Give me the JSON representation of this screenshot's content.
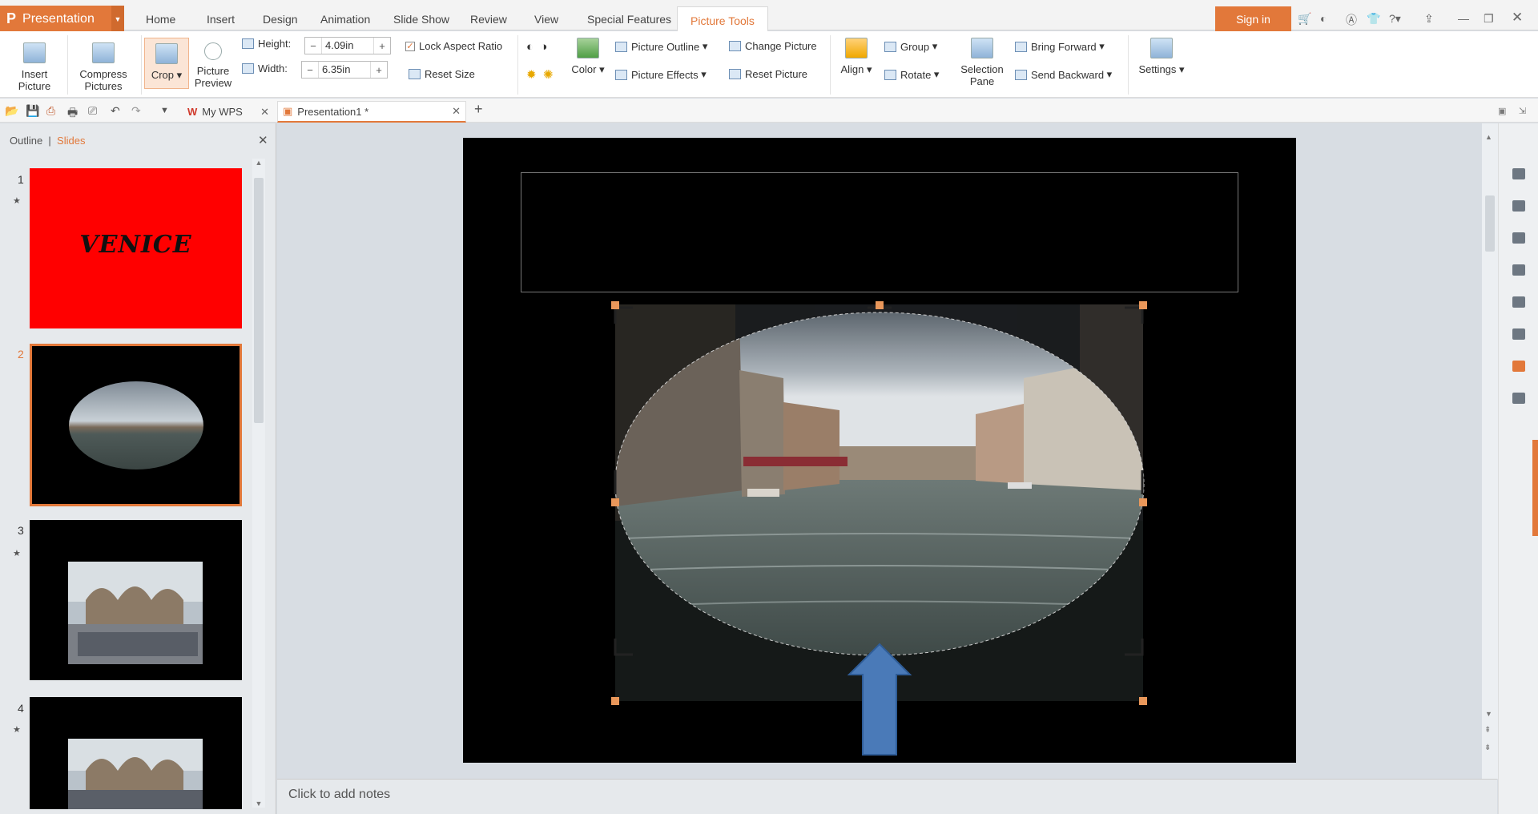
{
  "app": {
    "name": "Presentation",
    "logo": "P"
  },
  "menu": [
    "Home",
    "Insert",
    "Design",
    "Animation",
    "Slide Show",
    "Review",
    "View",
    "Special Features",
    "Picture Tools"
  ],
  "signin": "Sign in",
  "ribbon": {
    "insert_picture": "Insert\nPicture",
    "compress": "Compress\nPictures",
    "crop": "Crop",
    "preview": "Picture\nPreview",
    "height_label": "Height:",
    "height_value": "4.09in",
    "width_label": "Width:",
    "width_value": "6.35in",
    "lock_aspect": "Lock Aspect Ratio",
    "reset_size": "Reset Size",
    "color": "Color",
    "picture_outline": "Picture Outline",
    "picture_effects": "Picture Effects",
    "change_picture": "Change Picture",
    "reset_picture": "Reset Picture",
    "align": "Align",
    "group": "Group",
    "rotate": "Rotate",
    "selection_pane": "Selection\nPane",
    "bring_forward": "Bring Forward",
    "send_backward": "Send Backward",
    "settings": "Settings"
  },
  "tabs": {
    "mywps": "My WPS",
    "doc": "Presentation1 *"
  },
  "leftpane": {
    "outline": "Outline",
    "slides": "Slides",
    "slide1_title": "VENICE"
  },
  "slides": [
    {
      "num": "1",
      "bg": "#ff0000"
    },
    {
      "num": "2",
      "bg": "#000000"
    },
    {
      "num": "3",
      "bg": "#000000"
    },
    {
      "num": "4",
      "bg": "#000000"
    }
  ],
  "notes": "Click to add notes",
  "colors": {
    "accent": "#e2783a",
    "arrow": "#4a7ab8"
  }
}
